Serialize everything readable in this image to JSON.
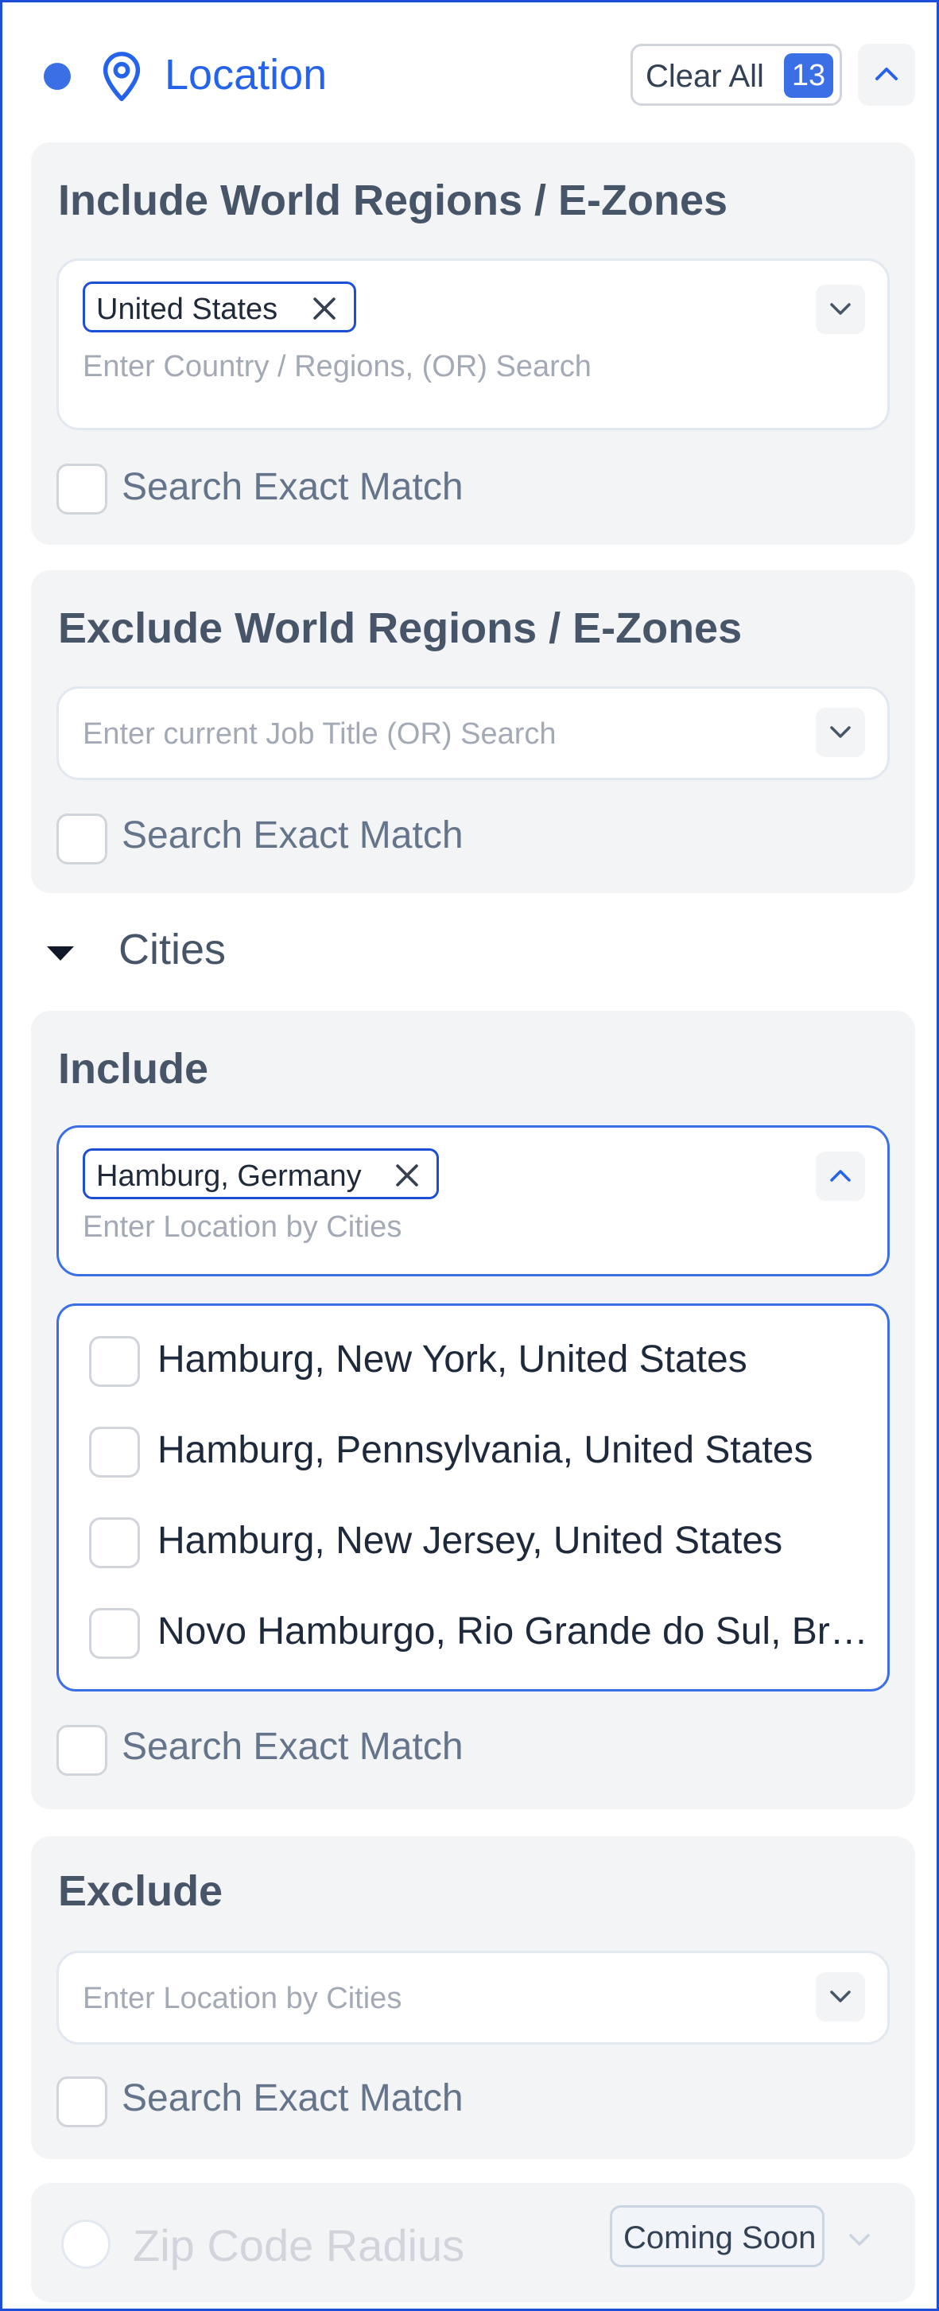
{
  "header": {
    "title": "Location",
    "clear_all_label": "Clear All",
    "count": "13"
  },
  "include_regions": {
    "title": "Include World Regions / E-Zones",
    "chip": "United States",
    "placeholder": "Enter Country / Regions, (OR) Search",
    "exact_match": "Search Exact Match"
  },
  "exclude_regions": {
    "title": "Exclude World Regions / E-Zones",
    "placeholder": "Enter current Job Title (OR) Search",
    "exact_match": "Search Exact Match"
  },
  "cities": {
    "label": "Cities",
    "include": {
      "title": "Include",
      "chip": "Hamburg, Germany",
      "placeholder": "Enter Location by Cities",
      "options": [
        "Hamburg, New York, United States",
        "Hamburg, Pennsylvania, United States",
        "Hamburg, New Jersey, United States",
        "Novo Hamburgo, Rio Grande do Sul, Brazil"
      ],
      "exact_match": "Search Exact Match"
    },
    "exclude": {
      "title": "Exclude",
      "placeholder": "Enter Location by Cities",
      "exact_match": "Search Exact Match"
    }
  },
  "zip": {
    "label": "Zip Code Radius",
    "badge": "Coming Soon"
  },
  "colors": {
    "accent": "#3b6fe6",
    "accent_dark": "#1d4ed8",
    "card_bg": "#f3f4f6"
  }
}
